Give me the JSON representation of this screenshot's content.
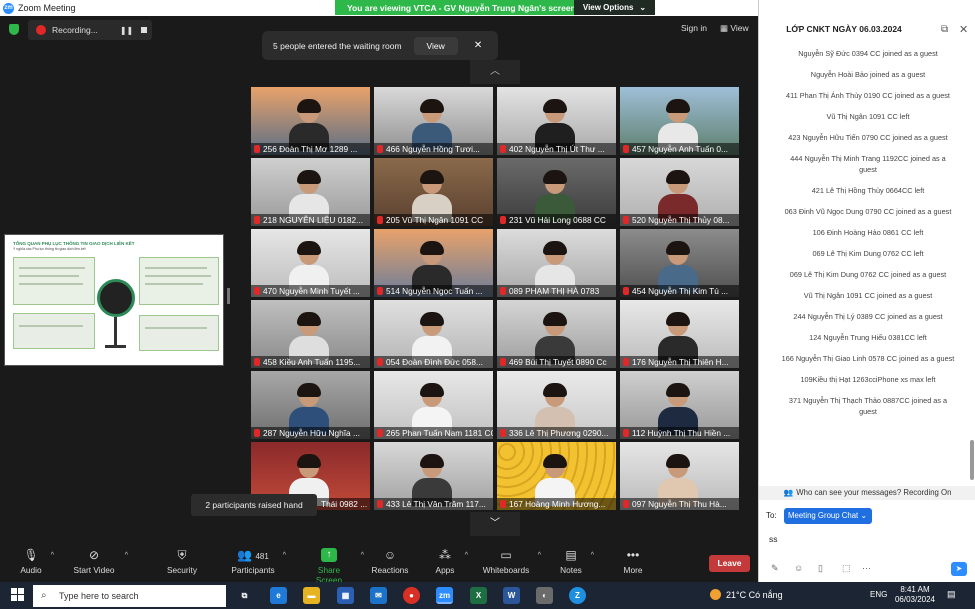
{
  "window": {
    "title": "Zoom Meeting"
  },
  "share_banner": {
    "text": "You are viewing VTCA - GV Nguyễn Trung Ngân's screen",
    "view_options": "View Options"
  },
  "top": {
    "recording": "Recording...",
    "signin": "Sign in",
    "view": "View"
  },
  "waiting_room": {
    "message": "5 people entered the waiting room",
    "button": "View"
  },
  "share_thumb": {
    "heading": "TỔNG QUAN PHỤ LỤC THÔNG TIN GIAO DỊCH LIÊN KẾT",
    "subheading": "Ý nghĩa các Phụ lục thông tin giao dịch liên kết"
  },
  "tiles": [
    {
      "name": "256 Đoàn Thị Mơ 1289 ..."
    },
    {
      "name": "466 Nguyễn Hồng Tươi..."
    },
    {
      "name": "402 Nguyễn Thị Út Thư ..."
    },
    {
      "name": "457 Nguyễn Anh Tuấn 0..."
    },
    {
      "name": "218 NGUYỄN LIỆU 0182..."
    },
    {
      "name": "205 Vũ Thị Ngân 1091 CC"
    },
    {
      "name": "231 Vũ Hải Long 0688 CC"
    },
    {
      "name": "520 Nguyễn Thị Thủy 08..."
    },
    {
      "name": "470 Nguyễn Minh Tuyết ..."
    },
    {
      "name": "514 Nguyễn Ngọc Tuấn ..."
    },
    {
      "name": "089 PHẠM THỊ HÀ 0783"
    },
    {
      "name": "454 Nguyễn Thị Kim Tú ..."
    },
    {
      "name": "458 Kiều Anh Tuấn 1195..."
    },
    {
      "name": "054 Đoàn Đình Đức 058..."
    },
    {
      "name": "469 Bùi Thị Tuyết 0890 Cc"
    },
    {
      "name": "176 Nguyễn Thị Thiên H..."
    },
    {
      "name": "287 Nguyễn Hữu Nghĩa ..."
    },
    {
      "name": "265 Phan Tuấn Nam 1181 CC"
    },
    {
      "name": "336 Lê Thị Phương 0290..."
    },
    {
      "name": "112 Huỳnh Thị Thu Hiền ..."
    },
    {
      "name": "Thái 0982 ..."
    },
    {
      "name": "433 Lê Thị Vân Trâm 117..."
    },
    {
      "name": "167 Hoàng Minh Hương..."
    },
    {
      "name": "097 Nguyễn Thị Thu Hà..."
    }
  ],
  "raised_hand": {
    "text": "2 participants raised hand"
  },
  "toolbar": {
    "audio": "Audio",
    "start_video": "Start Video",
    "security": "Security",
    "participants": "Participants",
    "participants_count": "481",
    "share_screen": "Share Screen",
    "reactions": "Reactions",
    "apps": "Apps",
    "whiteboards": "Whiteboards",
    "notes": "Notes",
    "more": "More",
    "leave": "Leave"
  },
  "chat": {
    "title": "LỚP CNKT NGÀY 06.03.2024",
    "messages": [
      "Nguyễn Sỹ Đức 0394 CC joined as a guest",
      "Nguyễn Hoài Bảo joined as a guest",
      "411 Phan Thị Ánh Thủy 0190 CC joined as a guest",
      "Vũ Thị Ngân 1091 CC left",
      "423 Nguyễn Hữu Tiến 0790 CC joined as a guest",
      "444 Nguyễn Thị Minh Trang 1192CC joined as a guest",
      "421 Lê Thị Hồng Thủy 0664CC left",
      "063 Đinh Vũ Ngọc Dung 0790 CC joined as a guest",
      "106 Đinh Hoàng Hảo 0861 CC left",
      "069 Lê Thị Kim Dung 0762 CC left",
      "069 Lê Thị Kim Dung 0762 CC joined as a guest",
      "Vũ Thị Ngân 1091 CC joined as a guest",
      "244 Nguyễn Thị Lý 0389 CC joined as a guest",
      "124 Nguyễn Trung Hiếu 0381CC left",
      "166 Nguyễn Thị Giao Linh 0578 CC joined as a guest",
      "109Kiều thị Hạt 1263cciPhone xs max left",
      "371 Nguyễn Thị Thạch Thảo 0887CC joined as a guest"
    ],
    "who_can_see": "Who can see your messages? Recording On",
    "to_label": "To:",
    "to_value": "Meeting Group Chat",
    "input_value": "ss"
  },
  "taskbar": {
    "search_placeholder": "Type here to search",
    "weather": "21°C  Có nắng",
    "lang": "ENG",
    "time": "8:41 AM",
    "date": "06/03/2024"
  }
}
